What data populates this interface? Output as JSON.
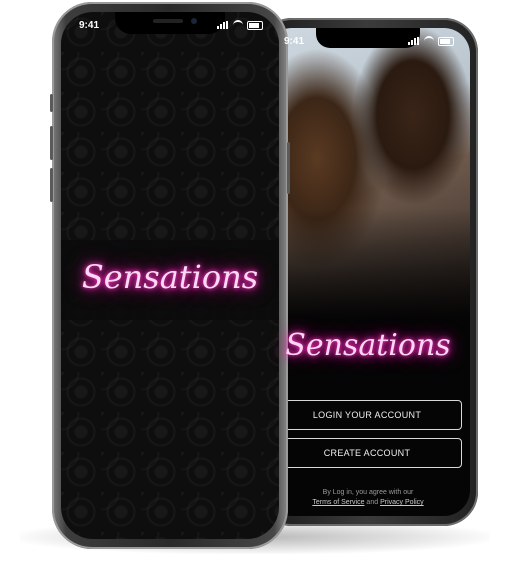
{
  "front_screen": {
    "status_time": "9:41",
    "logo_text": "Sensations"
  },
  "back_screen": {
    "status_time": "9:41",
    "logo_text": "Sensations",
    "login_button": "LOGIN YOUR ACCOUNT",
    "create_button": "CREATE ACCOUNT",
    "legal_prefix": "By Log in, you agree with our",
    "terms_link": "Terms of Service",
    "legal_and": "and",
    "privacy_link": "Privacy Policy"
  },
  "icons": {
    "signal": "signal-icon",
    "wifi": "wifi-icon",
    "battery": "battery-icon"
  },
  "colors": {
    "neon_pink": "#ff1fb9",
    "screen_bg": "#0e0e0e"
  }
}
